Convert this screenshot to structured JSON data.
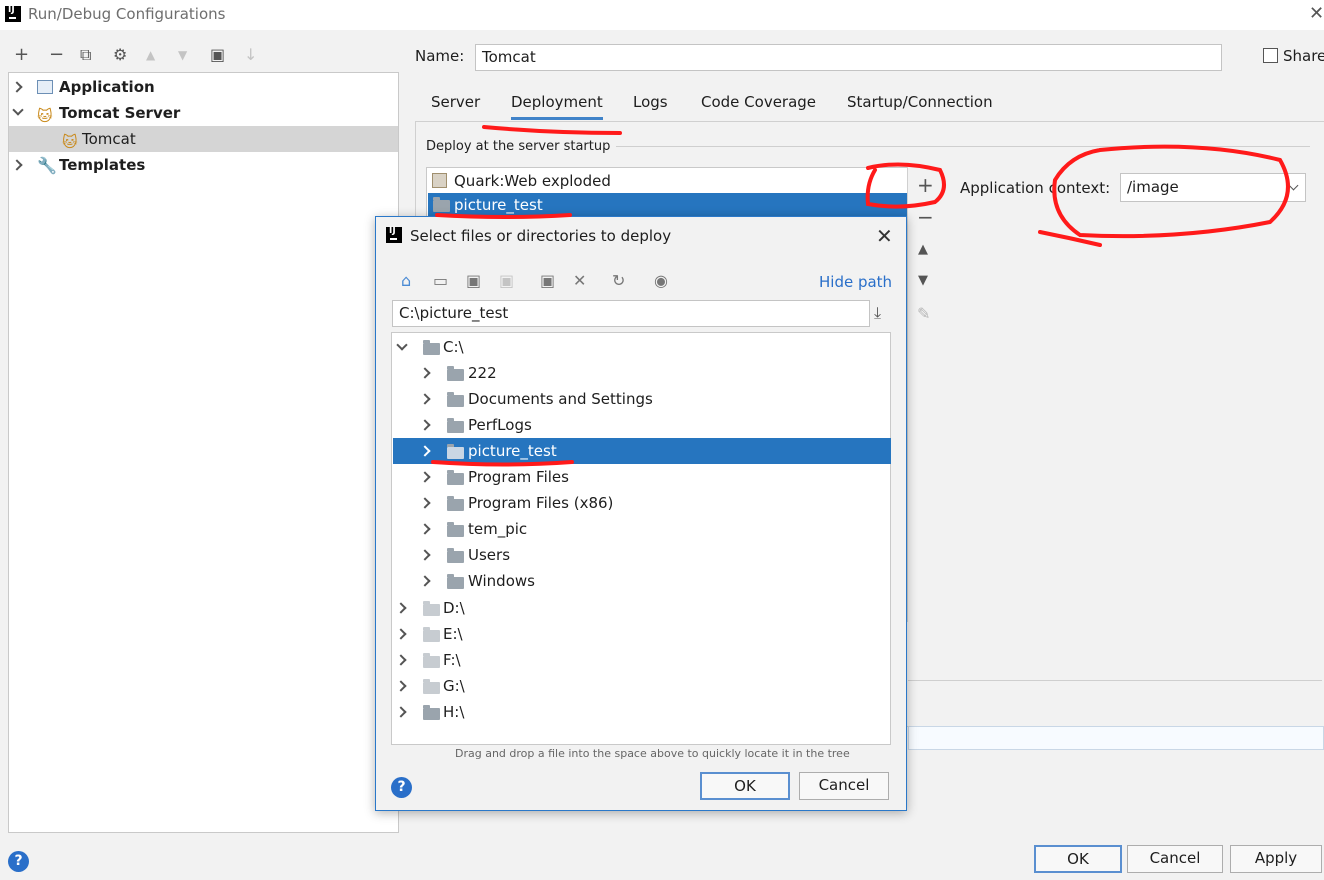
{
  "window": {
    "title": "Run/Debug Configurations"
  },
  "toolbar": {
    "add": "+",
    "remove": "−",
    "copy": "⧉",
    "edit": "⚙",
    "up": "▲",
    "down": "▼",
    "folder": "▣",
    "sort": "↓"
  },
  "left_tree": {
    "items": [
      {
        "label": "Application"
      },
      {
        "label": "Tomcat Server"
      },
      {
        "label": "Tomcat"
      },
      {
        "label": "Templates"
      }
    ]
  },
  "form": {
    "name_label": "Name:",
    "name_value": "Tomcat",
    "share_label": "Share"
  },
  "tabs": [
    {
      "label": "Server"
    },
    {
      "label": "Deployment"
    },
    {
      "label": "Logs"
    },
    {
      "label": "Code Coverage"
    },
    {
      "label": "Startup/Connection"
    }
  ],
  "deployment": {
    "section_title": "Deploy at the server startup",
    "items": [
      {
        "label": "Quark:Web exploded"
      },
      {
        "label": "picture_test"
      }
    ],
    "context_label": "Application context:",
    "context_value": "/image"
  },
  "bottom": {
    "ok": "OK",
    "cancel": "Cancel",
    "apply": "Apply",
    "help": "?"
  },
  "dialog": {
    "title": "Select files or directories to deploy",
    "close": "✕",
    "hide_path": "Hide path",
    "path_value": "C:\\picture_test",
    "tree": [
      {
        "label": "C:\\"
      },
      {
        "label": "222"
      },
      {
        "label": "Documents and Settings"
      },
      {
        "label": "PerfLogs"
      },
      {
        "label": "picture_test"
      },
      {
        "label": "Program Files"
      },
      {
        "label": "Program Files (x86)"
      },
      {
        "label": "tem_pic"
      },
      {
        "label": "Users"
      },
      {
        "label": "Windows"
      },
      {
        "label": "D:\\"
      },
      {
        "label": "E:\\"
      },
      {
        "label": "F:\\"
      },
      {
        "label": "G:\\"
      },
      {
        "label": "H:\\"
      }
    ],
    "drag_hint": "Drag and drop a file into the space above to quickly locate it in the tree",
    "ok": "OK",
    "cancel": "Cancel",
    "help": "?"
  },
  "colors": {
    "selection": "#2675bf",
    "link": "#2a6fc9",
    "annotation": "#ff1a1a"
  }
}
